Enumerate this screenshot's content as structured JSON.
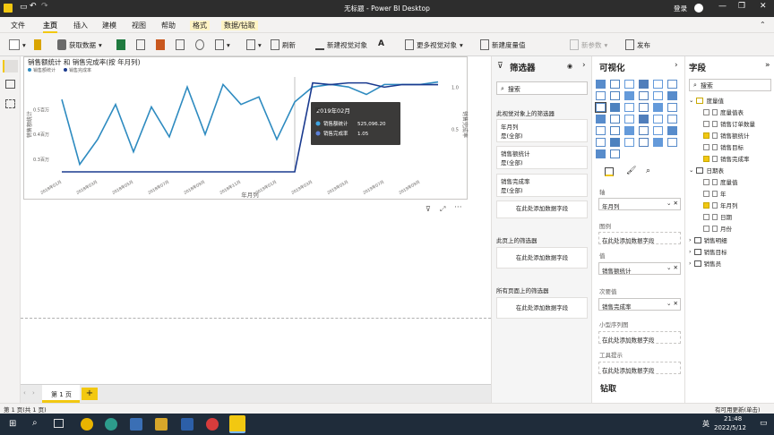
{
  "window": {
    "title": "无标题 - Power BI Desktop",
    "signin": "登录"
  },
  "menu": {
    "tabs": [
      "文件",
      "主页",
      "插入",
      "建模",
      "视图",
      "帮助",
      "格式",
      "数据/钻取"
    ],
    "active": "主页"
  },
  "ribbon": {
    "get_data": "获取数据",
    "refresh": "刷新",
    "new_visual": "新建视觉对象",
    "more_visuals": "更多视觉对象",
    "new_measure": "新建度量值",
    "new_param": "新参数",
    "publish": "发布"
  },
  "chart_data": {
    "type": "line",
    "title": "销售额统计 和 销售完成率(按 年月列)",
    "xlabel": "年月列",
    "ylabel": "销售额统计",
    "y2label": "销售完成率",
    "legend": [
      "销售额统计",
      "销售完成率"
    ],
    "categories": [
      "2018年01月",
      "2018年02月",
      "2018年03月",
      "2018年04月",
      "2018年05月",
      "2018年06月",
      "2018年07月",
      "2018年08月",
      "2018年09月",
      "2018年10月",
      "2018年11月",
      "2018年12月",
      "2019年01月",
      "2019年02月",
      "2019年03月",
      "2019年04月",
      "2019年05月",
      "2019年06月",
      "2019年07月",
      "2019年08月",
      "2019年09月",
      "2019年10月"
    ],
    "x_tick_labels": [
      "2018年01月",
      "2018年03月",
      "2018年05月",
      "2018年07月",
      "2018年09月",
      "2018年11月",
      "2019年01月",
      "2019年03月",
      "2019年05月",
      "2019年07月",
      "2019年09月"
    ],
    "y_tick_labels": [
      "0.3百万",
      "0.4百万",
      "0.5百万"
    ],
    "y2_tick_labels": [
      "1.0",
      "0.5"
    ],
    "series": [
      {
        "name": "销售额统计",
        "color": "#2e8bc0",
        "values": [
          0.54,
          0.28,
          0.38,
          0.52,
          0.33,
          0.51,
          0.39,
          0.59,
          0.4,
          0.6,
          0.52,
          0.55,
          0.38,
          0.53,
          0.59,
          0.6,
          0.59,
          0.56,
          0.6,
          0.6,
          0.6,
          0.61
        ]
      },
      {
        "name": "销售完成率",
        "color": "#1a3a8f",
        "values": [
          0,
          0,
          0,
          0,
          0,
          0,
          0,
          0,
          0,
          0,
          0,
          0,
          0,
          0,
          1.05,
          1.03,
          1.05,
          1.05,
          1.0,
          1.03,
          1.03,
          1.03
        ]
      }
    ],
    "tooltip": {
      "title": "2019年02月",
      "rows": [
        {
          "label": "销售额统计",
          "value": "525,096.20"
        },
        {
          "label": "销售完成率",
          "value": "1.05"
        }
      ]
    }
  },
  "filters": {
    "title": "筛选器",
    "search": "搜索",
    "section_visual": "此视觉对象上的筛选器",
    "cards": [
      {
        "name": "年月列",
        "state": "是(全部)"
      },
      {
        "name": "销售额统计",
        "state": "是(全部)"
      },
      {
        "name": "销售完成率",
        "state": "是(全部)"
      }
    ],
    "add_field": "在此处添加数据字段",
    "section_page": "此页上的筛选器",
    "section_all": "所有页面上的筛选器"
  },
  "visualizations": {
    "title": "可视化",
    "wells": [
      {
        "label": "轴",
        "value": "年月列"
      },
      {
        "label": "图例",
        "value": "在此处添加数据字段"
      },
      {
        "label": "值",
        "value": "销售额统计"
      },
      {
        "label": "次要值",
        "value": "销售完成率"
      },
      {
        "label": "小型序列图",
        "value": "在此处添加数据字段"
      },
      {
        "label": "工具提示",
        "value": "在此处添加数据字段"
      }
    ],
    "drill": "钻取"
  },
  "fields": {
    "title": "字段",
    "search": "搜索",
    "tables": [
      {
        "name": "度量值",
        "expanded": true,
        "items": [
          {
            "name": "度量值表",
            "checked": false
          },
          {
            "name": "销售订单数量",
            "checked": false
          },
          {
            "name": "销售额统计",
            "checked": true
          },
          {
            "name": "销售目标",
            "checked": false
          },
          {
            "name": "销售完成率",
            "checked": true
          }
        ]
      },
      {
        "name": "日期表",
        "expanded": true,
        "items": [
          {
            "name": "度量值",
            "checked": false
          },
          {
            "name": "年",
            "checked": false
          },
          {
            "name": "年月列",
            "checked": true
          },
          {
            "name": "日期",
            "checked": false
          },
          {
            "name": "月份",
            "checked": false
          }
        ]
      },
      {
        "name": "销售明细",
        "expanded": false,
        "items": []
      },
      {
        "name": "销售目标",
        "expanded": false,
        "items": []
      },
      {
        "name": "销售员",
        "expanded": false,
        "items": []
      }
    ]
  },
  "pages": {
    "tabs": [
      "第 1 页"
    ],
    "add": "+"
  },
  "status": {
    "left": "第 1 页(共 1 页)",
    "right": "有可用更新(单击)"
  },
  "clock": {
    "time": "21:48",
    "date": "2022/5/12",
    "lang": "英"
  }
}
